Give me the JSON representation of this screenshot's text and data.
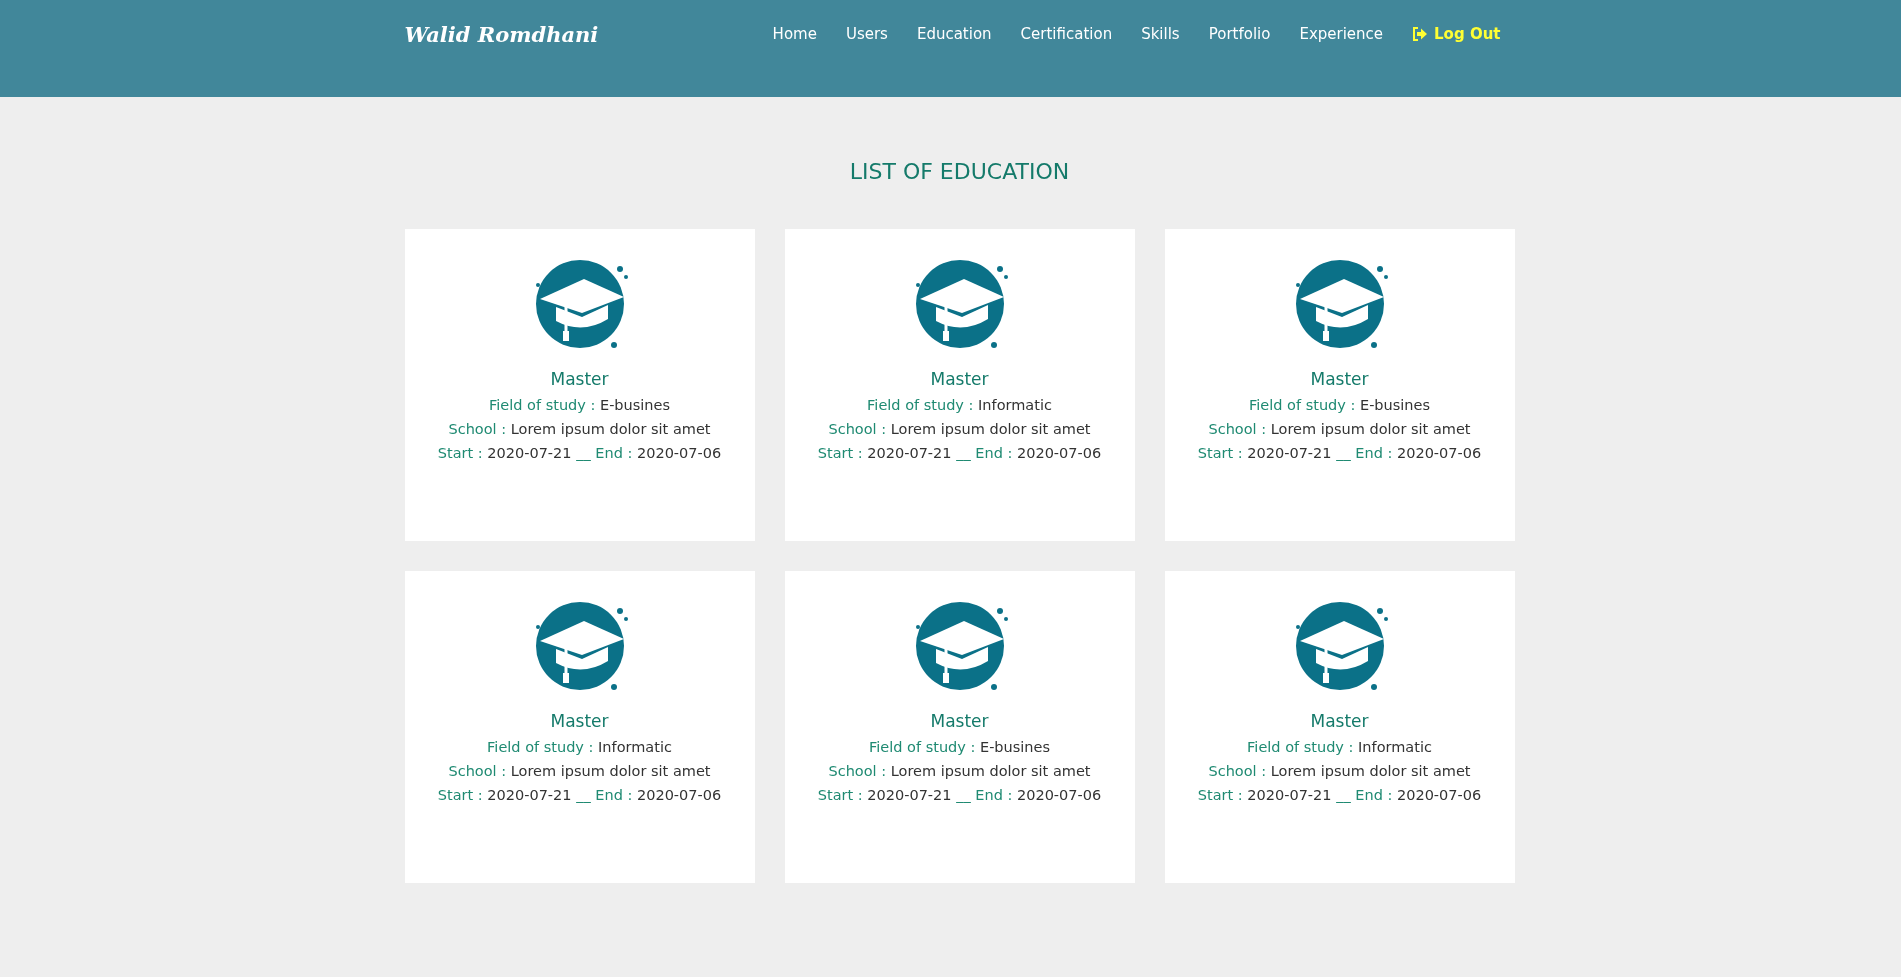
{
  "brand": "Walid Romdhani",
  "nav": [
    {
      "label": "Home",
      "kind": "link"
    },
    {
      "label": "Users",
      "kind": "link"
    },
    {
      "label": "Education",
      "kind": "link"
    },
    {
      "label": "Certification",
      "kind": "link"
    },
    {
      "label": "Skills",
      "kind": "link"
    },
    {
      "label": "Portfolio",
      "kind": "link"
    },
    {
      "label": "Experience",
      "kind": "link"
    },
    {
      "label": "Log Out",
      "kind": "logout"
    }
  ],
  "title": "LIST OF EDUCATION",
  "cards": [
    {
      "degree": "Master",
      "field": {
        "label": "Field of study :",
        "value": "E-busines"
      },
      "school": {
        "label": "School :",
        "value": "Lorem ipsum dolor sit amet"
      },
      "start": {
        "label": "Start :",
        "value": "2020-07-21"
      },
      "separator": "__",
      "end": {
        "label": "End :",
        "value": "2020-07-06"
      }
    },
    {
      "degree": "Master",
      "field": {
        "label": "Field of study :",
        "value": "Informatic"
      },
      "school": {
        "label": "School :",
        "value": "Lorem ipsum dolor sit amet"
      },
      "start": {
        "label": "Start :",
        "value": "2020-07-21"
      },
      "separator": "__",
      "end": {
        "label": "End :",
        "value": "2020-07-06"
      }
    },
    {
      "degree": "Master",
      "field": {
        "label": "Field of study :",
        "value": "E-busines"
      },
      "school": {
        "label": "School :",
        "value": "Lorem ipsum dolor sit amet"
      },
      "start": {
        "label": "Start :",
        "value": "2020-07-21"
      },
      "separator": "__",
      "end": {
        "label": "End :",
        "value": "2020-07-06"
      }
    },
    {
      "degree": "Master",
      "field": {
        "label": "Field of study :",
        "value": "Informatic"
      },
      "school": {
        "label": "School :",
        "value": "Lorem ipsum dolor sit amet"
      },
      "start": {
        "label": "Start :",
        "value": "2020-07-21"
      },
      "separator": "__",
      "end": {
        "label": "End :",
        "value": "2020-07-06"
      }
    },
    {
      "degree": "Master",
      "field": {
        "label": "Field of study :",
        "value": "E-busines"
      },
      "school": {
        "label": "School :",
        "value": "Lorem ipsum dolor sit amet"
      },
      "start": {
        "label": "Start :",
        "value": "2020-07-21"
      },
      "separator": "__",
      "end": {
        "label": "End :",
        "value": "2020-07-06"
      }
    },
    {
      "degree": "Master",
      "field": {
        "label": "Field of study :",
        "value": "Informatic"
      },
      "school": {
        "label": "School :",
        "value": "Lorem ipsum dolor sit amet"
      },
      "start": {
        "label": "Start :",
        "value": "2020-07-21"
      },
      "separator": "__",
      "end": {
        "label": "End :",
        "value": "2020-07-06"
      }
    }
  ]
}
